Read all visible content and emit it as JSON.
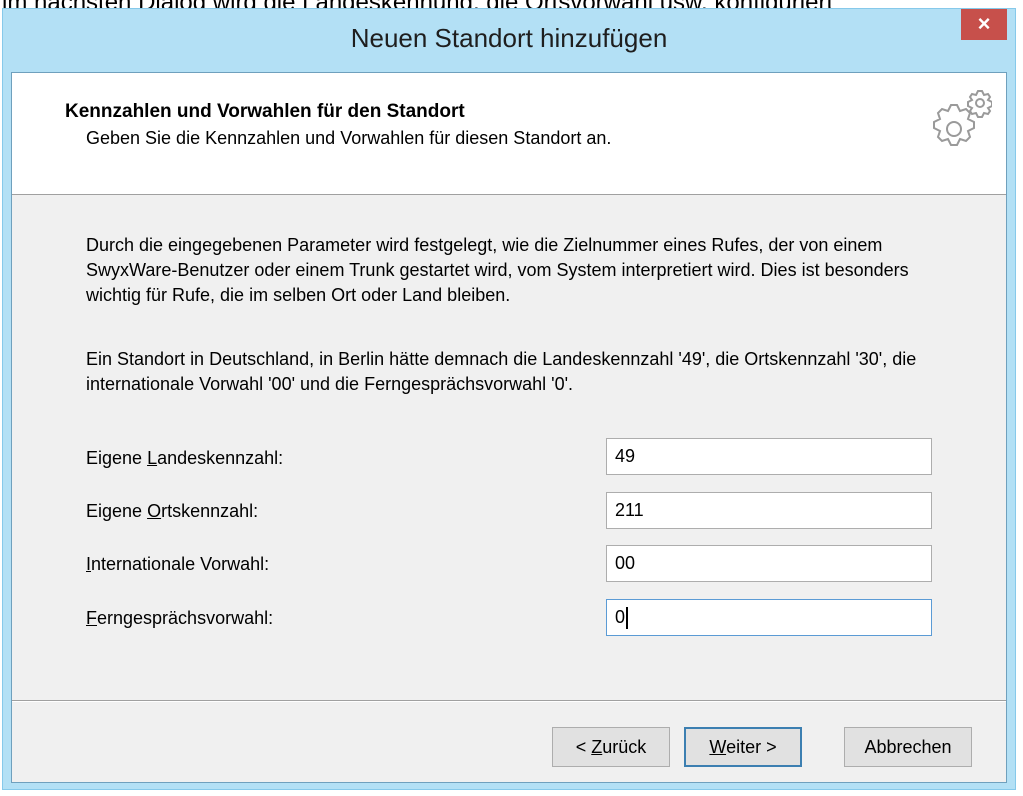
{
  "background_caption": "im nächsten Dialog wird die Landeskennung, die Ortsvorwahl usw. konfiguriert",
  "window": {
    "title": "Neuen Standort hinzufügen",
    "close_glyph": "×"
  },
  "header": {
    "title": "Kennzahlen und Vorwahlen für den Standort",
    "subtitle": "Geben Sie die Kennzahlen und Vorwahlen für diesen Standort an.",
    "icon": "gears-icon"
  },
  "body": {
    "paragraph1": "Durch die eingegebenen Parameter wird festgelegt, wie die Zielnummer eines Rufes, der von einem SwyxWare-Benutzer oder einem Trunk gestartet wird, vom System interpretiert wird. Dies ist besonders wichtig für Rufe, die im selben Ort oder Land bleiben.",
    "paragraph2": "Ein Standort in Deutschland, in Berlin hätte demnach die Landeskennzahl '49', die Ortskennzahl '30', die internationale Vorwahl '00' und die Ferngesprächsvorwahl '0'."
  },
  "fields": [
    {
      "label_pre": "Eigene ",
      "label_accel": "L",
      "label_post": "andeskennzahl:",
      "value": "49"
    },
    {
      "label_pre": "Eigene ",
      "label_accel": "O",
      "label_post": "rtskennzahl:",
      "value": "211"
    },
    {
      "label_pre": "",
      "label_accel": "I",
      "label_post": "nternationale Vorwahl:",
      "value": "00"
    },
    {
      "label_pre": "",
      "label_accel": "F",
      "label_post": "erngesprächsvorwahl:",
      "value": "0"
    }
  ],
  "buttons": {
    "back": {
      "prefix": "< ",
      "accel": "Z",
      "rest": "urück"
    },
    "next": {
      "prefix": "",
      "accel": "W",
      "rest": "eiter >"
    },
    "cancel": "Abbrechen"
  },
  "colors": {
    "frame": "#b3e0f5",
    "close_button": "#c7504b",
    "default_button_border": "#3c7fb1"
  }
}
